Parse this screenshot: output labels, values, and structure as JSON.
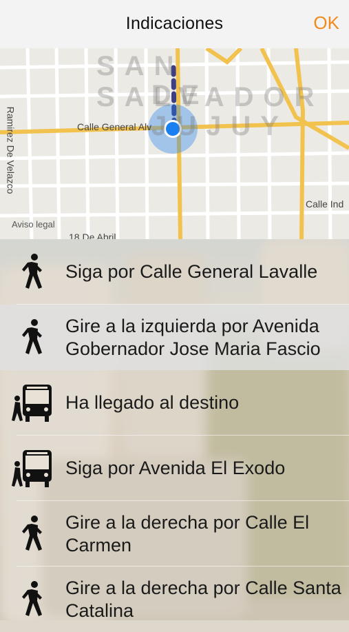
{
  "header": {
    "title": "Indicaciones",
    "ok_label": "OK"
  },
  "map": {
    "city_line1": "SAN SALVADOR",
    "city_line2": "DE JUJUY",
    "street_1": "Calle General Alv",
    "street_2": "Ramirez De Velazco",
    "street_3": "Calle Ind",
    "street_4": "18 De Abril",
    "legal": "Aviso legal"
  },
  "steps": [
    {
      "icon": "walk-icon",
      "text": "Siga por Calle General Lavalle"
    },
    {
      "icon": "walk-icon",
      "text": "Gire a la izquierda por Avenida Gobernador Jose Maria Fascio"
    },
    {
      "icon": "bus-icon",
      "text": "Ha llegado al destino"
    },
    {
      "icon": "bus-icon",
      "text": "Siga por Avenida El Exodo"
    },
    {
      "icon": "walk-icon",
      "text": "Gire a la derecha por Calle El Carmen"
    },
    {
      "icon": "walk-icon",
      "text": "Gire a la derecha por Calle Santa Catalina"
    }
  ],
  "colors": {
    "accent": "#f08a1e",
    "location": "#1a7ff0",
    "road": "#f2c24f"
  }
}
